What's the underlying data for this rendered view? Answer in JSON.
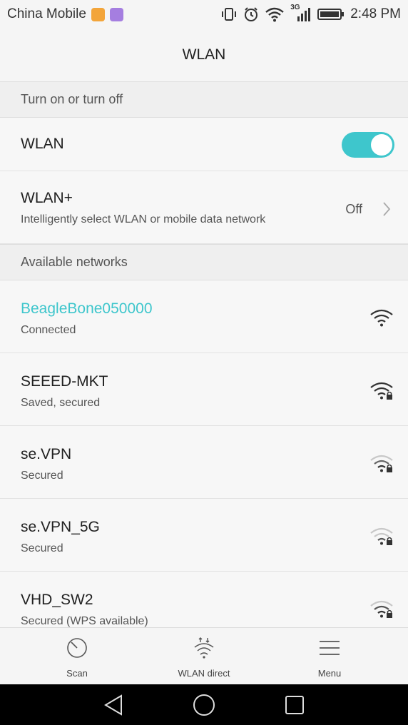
{
  "status_bar": {
    "carrier": "China Mobile",
    "network_type": "3G",
    "time": "2:48 PM"
  },
  "header": {
    "title": "WLAN"
  },
  "sections": {
    "toggle": "Turn on or turn off",
    "available": "Available networks"
  },
  "wlan_toggle": {
    "label": "WLAN",
    "enabled": true
  },
  "wlan_plus": {
    "title": "WLAN+",
    "subtitle": "Intelligently select WLAN or mobile data network",
    "value": "Off"
  },
  "networks": [
    {
      "name": "BeagleBone050000",
      "status": "Connected"
    },
    {
      "name": "SEEED-MKT",
      "status": "Saved, secured"
    },
    {
      "name": "se.VPN",
      "status": "Secured"
    },
    {
      "name": "se.VPN_5G",
      "status": "Secured"
    },
    {
      "name": "VHD_SW2",
      "status": "Secured (WPS available)"
    }
  ],
  "bottom_bar": {
    "scan": "Scan",
    "wlan_direct": "WLAN direct",
    "menu": "Menu"
  },
  "colors": {
    "accent": "#3ec6cc",
    "background": "#f5f5f5",
    "nav_bar": "#000000"
  }
}
